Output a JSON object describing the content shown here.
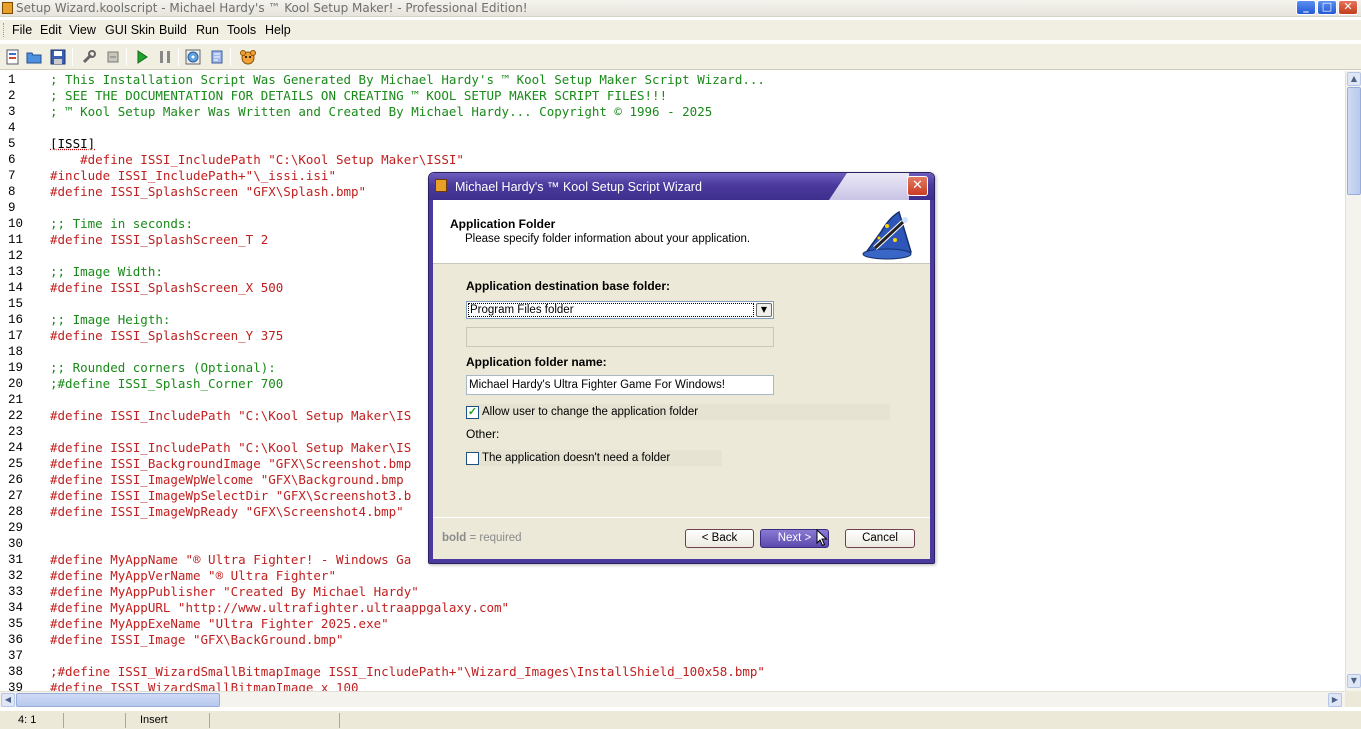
{
  "window": {
    "title": "Setup Wizard.koolscript - Michael Hardy's ™ Kool Setup Maker! - Professional Edition!",
    "min": "_",
    "max": "□",
    "close": "✕"
  },
  "menu": [
    "File",
    "Edit",
    "View",
    "GUI Skin",
    "Build",
    "Run",
    "Tools",
    "Help"
  ],
  "toolbar_icons": [
    "new-file-icon",
    "open-folder-icon",
    "save-icon",
    "wrench-icon",
    "plugin-icon",
    "play-icon",
    "pause-icon",
    "disc-icon",
    "script-icon",
    "mascot-icon"
  ],
  "editor": {
    "lines": [
      {
        "n": "1",
        "t": "; This Installation Script Was Generated By Michael Hardy's ™ Kool Setup Maker Script Wizard...",
        "k": "comment"
      },
      {
        "n": "2",
        "t": "; SEE THE DOCUMENTATION FOR DETAILS ON CREATING ™ KOOL SETUP MAKER SCRIPT FILES!!!",
        "k": "comment"
      },
      {
        "n": "3",
        "t": "; ™ Kool Setup Maker Was Written and Created By Michael Hardy... Copyright © 1996 - 2025",
        "k": "comment"
      },
      {
        "n": "4",
        "t": "",
        "k": "plain"
      },
      {
        "n": "5",
        "t": "[ISSI]",
        "k": "section"
      },
      {
        "n": "6",
        "t": "    #define ISSI_IncludePath \"C:\\Kool Setup Maker\\ISSI\"",
        "k": "define"
      },
      {
        "n": "7",
        "t": "#include ISSI_IncludePath+\"\\_issi.isi\"",
        "k": "define"
      },
      {
        "n": "8",
        "t": "#define ISSI_SplashScreen \"GFX\\Splash.bmp\"",
        "k": "define"
      },
      {
        "n": "9",
        "t": "",
        "k": "plain"
      },
      {
        "n": "10",
        "t": ";; Time in seconds:",
        "k": "comment"
      },
      {
        "n": "11",
        "t": "#define ISSI_SplashScreen_T 2",
        "k": "define"
      },
      {
        "n": "12",
        "t": "",
        "k": "plain"
      },
      {
        "n": "13",
        "t": ";; Image Width:",
        "k": "comment"
      },
      {
        "n": "14",
        "t": "#define ISSI_SplashScreen_X 500",
        "k": "define"
      },
      {
        "n": "15",
        "t": "",
        "k": "plain"
      },
      {
        "n": "16",
        "t": ";; Image Heigth:",
        "k": "comment"
      },
      {
        "n": "17",
        "t": "#define ISSI_SplashScreen_Y 375",
        "k": "define"
      },
      {
        "n": "18",
        "t": "",
        "k": "plain"
      },
      {
        "n": "19",
        "t": ";; Rounded corners (Optional):",
        "k": "comment"
      },
      {
        "n": "20",
        "t": ";#define ISSI_Splash_Corner 700",
        "k": "comment"
      },
      {
        "n": "21",
        "t": "",
        "k": "plain"
      },
      {
        "n": "22",
        "t": "#define ISSI_IncludePath \"C:\\Kool Setup Maker\\IS",
        "k": "define"
      },
      {
        "n": "23",
        "t": "",
        "k": "plain"
      },
      {
        "n": "24",
        "t": "#define ISSI_IncludePath \"C:\\Kool Setup Maker\\IS",
        "k": "define"
      },
      {
        "n": "25",
        "t": "#define ISSI_BackgroundImage \"GFX\\Screenshot.bmp",
        "k": "define"
      },
      {
        "n": "26",
        "t": "#define ISSI_ImageWpWelcome \"GFX\\Background.bmp",
        "k": "define"
      },
      {
        "n": "27",
        "t": "#define ISSI_ImageWpSelectDir \"GFX\\Screenshot3.b",
        "k": "define"
      },
      {
        "n": "28",
        "t": "#define ISSI_ImageWpReady \"GFX\\Screenshot4.bmp\"",
        "k": "define"
      },
      {
        "n": "29",
        "t": "",
        "k": "plain"
      },
      {
        "n": "30",
        "t": "",
        "k": "plain"
      },
      {
        "n": "31",
        "t": "#define MyAppName \"® Ultra Fighter! - Windows Ga",
        "k": "define"
      },
      {
        "n": "32",
        "t": "#define MyAppVerName \"® Ultra Fighter\"",
        "k": "define"
      },
      {
        "n": "33",
        "t": "#define MyAppPublisher \"Created By Michael Hardy\"",
        "k": "define"
      },
      {
        "n": "34",
        "t": "#define MyAppURL \"http://www.ultrafighter.ultraappgalaxy.com\"",
        "k": "define"
      },
      {
        "n": "35",
        "t": "#define MyAppExeName \"Ultra Fighter 2025.exe\"",
        "k": "define"
      },
      {
        "n": "36",
        "t": "#define ISSI_Image \"GFX\\BackGround.bmp\"",
        "k": "define"
      },
      {
        "n": "37",
        "t": "",
        "k": "plain"
      },
      {
        "n": "38",
        "t": ";#define ISSI_WizardSmallBitmapImage ISSI_IncludePath+\"\\Wizard_Images\\InstallShield_100x58.bmp\"",
        "k": "define"
      },
      {
        "n": "39",
        "t": "#define ISSI_WizardSmallBitmapImage_x 100",
        "k": "define"
      }
    ]
  },
  "statusbar": {
    "position": "4:  1",
    "mode": "Insert"
  },
  "dialog": {
    "title": "Michael Hardy's ™ Kool Setup Script Wizard",
    "close": "✕",
    "header_title": "Application Folder",
    "header_subtitle": "Please specify folder information about your application.",
    "dest_label": "Application destination base folder:",
    "dest_value": "Program Files folder",
    "custom_path_value": "",
    "folder_name_label": "Application folder name:",
    "folder_name_value": "Michael Hardy's Ultra Fighter Game For Windows!",
    "allow_change_label": "Allow user to change the application folder",
    "allow_change_checked": true,
    "other_label": "Other:",
    "no_folder_label": "The application doesn't need a folder",
    "no_folder_checked": false,
    "footer_bold": "bold",
    "footer_rest": " = required",
    "back": "< Back",
    "next": "Next >",
    "cancel": "Cancel"
  }
}
